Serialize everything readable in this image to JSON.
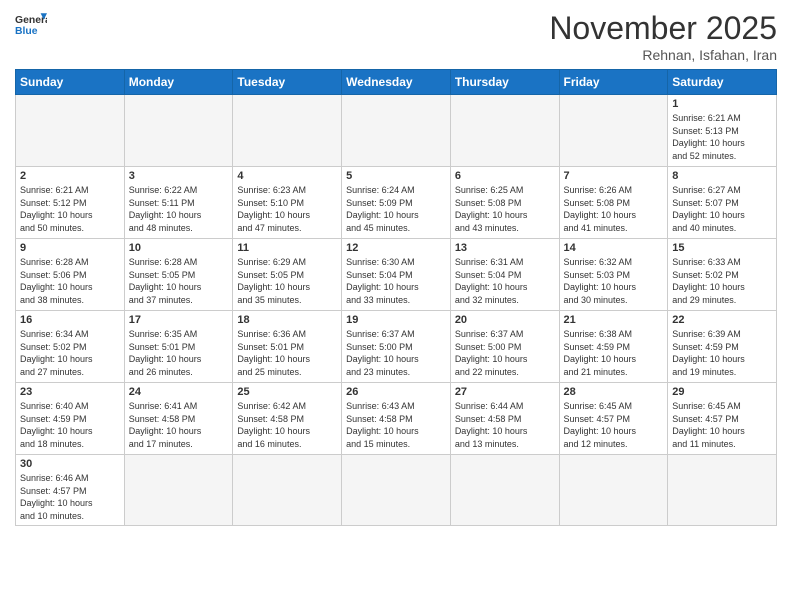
{
  "logo": {
    "text_general": "General",
    "text_blue": "Blue"
  },
  "title": "November 2025",
  "subtitle": "Rehnan, Isfahan, Iran",
  "weekdays": [
    "Sunday",
    "Monday",
    "Tuesday",
    "Wednesday",
    "Thursday",
    "Friday",
    "Saturday"
  ],
  "weeks": [
    [
      {
        "day": "",
        "empty": true
      },
      {
        "day": "",
        "empty": true
      },
      {
        "day": "",
        "empty": true
      },
      {
        "day": "",
        "empty": true
      },
      {
        "day": "",
        "empty": true
      },
      {
        "day": "",
        "empty": true
      },
      {
        "day": "1",
        "info": "Sunrise: 6:21 AM\nSunset: 5:13 PM\nDaylight: 10 hours\nand 52 minutes."
      }
    ],
    [
      {
        "day": "2",
        "info": "Sunrise: 6:21 AM\nSunset: 5:12 PM\nDaylight: 10 hours\nand 50 minutes."
      },
      {
        "day": "3",
        "info": "Sunrise: 6:22 AM\nSunset: 5:11 PM\nDaylight: 10 hours\nand 48 minutes."
      },
      {
        "day": "4",
        "info": "Sunrise: 6:23 AM\nSunset: 5:10 PM\nDaylight: 10 hours\nand 47 minutes."
      },
      {
        "day": "5",
        "info": "Sunrise: 6:24 AM\nSunset: 5:09 PM\nDaylight: 10 hours\nand 45 minutes."
      },
      {
        "day": "6",
        "info": "Sunrise: 6:25 AM\nSunset: 5:08 PM\nDaylight: 10 hours\nand 43 minutes."
      },
      {
        "day": "7",
        "info": "Sunrise: 6:26 AM\nSunset: 5:08 PM\nDaylight: 10 hours\nand 41 minutes."
      },
      {
        "day": "8",
        "info": "Sunrise: 6:27 AM\nSunset: 5:07 PM\nDaylight: 10 hours\nand 40 minutes."
      }
    ],
    [
      {
        "day": "9",
        "info": "Sunrise: 6:28 AM\nSunset: 5:06 PM\nDaylight: 10 hours\nand 38 minutes."
      },
      {
        "day": "10",
        "info": "Sunrise: 6:28 AM\nSunset: 5:05 PM\nDaylight: 10 hours\nand 37 minutes."
      },
      {
        "day": "11",
        "info": "Sunrise: 6:29 AM\nSunset: 5:05 PM\nDaylight: 10 hours\nand 35 minutes."
      },
      {
        "day": "12",
        "info": "Sunrise: 6:30 AM\nSunset: 5:04 PM\nDaylight: 10 hours\nand 33 minutes."
      },
      {
        "day": "13",
        "info": "Sunrise: 6:31 AM\nSunset: 5:04 PM\nDaylight: 10 hours\nand 32 minutes."
      },
      {
        "day": "14",
        "info": "Sunrise: 6:32 AM\nSunset: 5:03 PM\nDaylight: 10 hours\nand 30 minutes."
      },
      {
        "day": "15",
        "info": "Sunrise: 6:33 AM\nSunset: 5:02 PM\nDaylight: 10 hours\nand 29 minutes."
      }
    ],
    [
      {
        "day": "16",
        "info": "Sunrise: 6:34 AM\nSunset: 5:02 PM\nDaylight: 10 hours\nand 27 minutes."
      },
      {
        "day": "17",
        "info": "Sunrise: 6:35 AM\nSunset: 5:01 PM\nDaylight: 10 hours\nand 26 minutes."
      },
      {
        "day": "18",
        "info": "Sunrise: 6:36 AM\nSunset: 5:01 PM\nDaylight: 10 hours\nand 25 minutes."
      },
      {
        "day": "19",
        "info": "Sunrise: 6:37 AM\nSunset: 5:00 PM\nDaylight: 10 hours\nand 23 minutes."
      },
      {
        "day": "20",
        "info": "Sunrise: 6:37 AM\nSunset: 5:00 PM\nDaylight: 10 hours\nand 22 minutes."
      },
      {
        "day": "21",
        "info": "Sunrise: 6:38 AM\nSunset: 4:59 PM\nDaylight: 10 hours\nand 21 minutes."
      },
      {
        "day": "22",
        "info": "Sunrise: 6:39 AM\nSunset: 4:59 PM\nDaylight: 10 hours\nand 19 minutes."
      }
    ],
    [
      {
        "day": "23",
        "info": "Sunrise: 6:40 AM\nSunset: 4:59 PM\nDaylight: 10 hours\nand 18 minutes."
      },
      {
        "day": "24",
        "info": "Sunrise: 6:41 AM\nSunset: 4:58 PM\nDaylight: 10 hours\nand 17 minutes."
      },
      {
        "day": "25",
        "info": "Sunrise: 6:42 AM\nSunset: 4:58 PM\nDaylight: 10 hours\nand 16 minutes."
      },
      {
        "day": "26",
        "info": "Sunrise: 6:43 AM\nSunset: 4:58 PM\nDaylight: 10 hours\nand 15 minutes."
      },
      {
        "day": "27",
        "info": "Sunrise: 6:44 AM\nSunset: 4:58 PM\nDaylight: 10 hours\nand 13 minutes."
      },
      {
        "day": "28",
        "info": "Sunrise: 6:45 AM\nSunset: 4:57 PM\nDaylight: 10 hours\nand 12 minutes."
      },
      {
        "day": "29",
        "info": "Sunrise: 6:45 AM\nSunset: 4:57 PM\nDaylight: 10 hours\nand 11 minutes."
      }
    ],
    [
      {
        "day": "30",
        "info": "Sunrise: 6:46 AM\nSunset: 4:57 PM\nDaylight: 10 hours\nand 10 minutes."
      },
      {
        "day": "",
        "empty": true
      },
      {
        "day": "",
        "empty": true
      },
      {
        "day": "",
        "empty": true
      },
      {
        "day": "",
        "empty": true
      },
      {
        "day": "",
        "empty": true
      },
      {
        "day": "",
        "empty": true
      }
    ]
  ]
}
